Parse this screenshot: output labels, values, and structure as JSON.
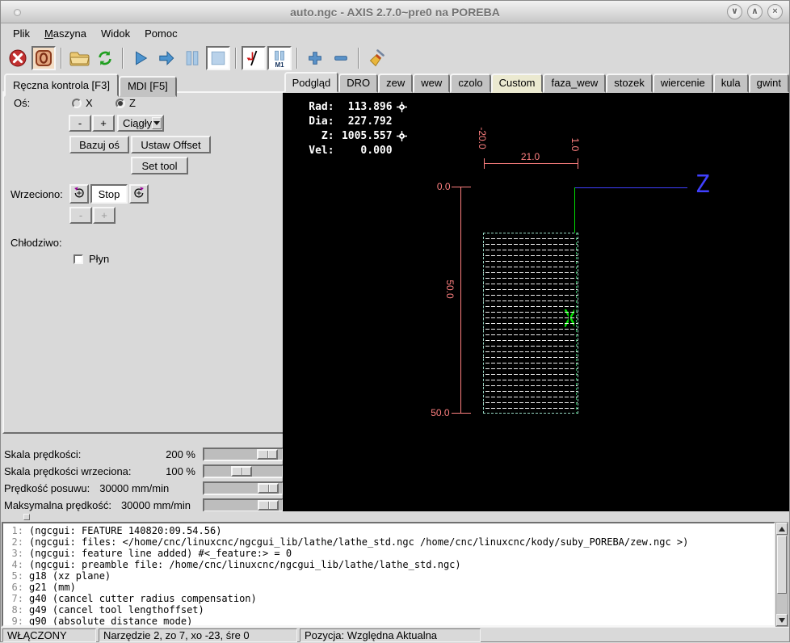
{
  "window": {
    "title": "auto.ngc - AXIS 2.7.0~pre0 na POREBA",
    "icons": {
      "minimize": "∨",
      "maximize": "∧",
      "close": "×"
    }
  },
  "menu": {
    "items": [
      {
        "u": "",
        "rest": "Plik"
      },
      {
        "u": "M",
        "rest": "aszyna"
      },
      {
        "u": "",
        "rest": "Widok"
      },
      {
        "u": "",
        "rest": "Pomoc"
      }
    ]
  },
  "toolbar": {
    "m1_label": "M1"
  },
  "left_panel": {
    "tabs": [
      {
        "label": "Ręczna kontrola [F3]"
      },
      {
        "label": "MDI [F5]"
      }
    ],
    "axis_row": {
      "label": "Oś:",
      "options": [
        {
          "label": "X",
          "selected": false
        },
        {
          "label": "Z",
          "selected": true
        }
      ]
    },
    "jog": {
      "minus": "-",
      "plus": "+",
      "mode": "Ciągły"
    },
    "buttons": {
      "home": "Bazuj oś",
      "offset": "Ustaw Offset",
      "set_tool": "Set tool"
    },
    "spindle": {
      "label": "Wrzeciono:",
      "stop": "Stop",
      "minus": "-",
      "plus": "+"
    },
    "coolant": {
      "label": "Chłodziwo:",
      "flood": "Płyn"
    },
    "sliders": [
      {
        "label": "Skala prędkości:",
        "value": "200 %"
      },
      {
        "label": "Skala prędkości wrzeciona:",
        "value": "100 %"
      },
      {
        "label": "Prędkość posuwu:",
        "value": "30000 mm/min"
      },
      {
        "label": "Maksymalna prędkość:",
        "value": "30000 mm/min"
      }
    ]
  },
  "right_panel": {
    "tabs": [
      {
        "label": "Podgląd"
      },
      {
        "label": "DRO"
      },
      {
        "label": "zew"
      },
      {
        "label": "wew"
      },
      {
        "label": "czolo"
      },
      {
        "label": "Custom"
      },
      {
        "label": "faza_wew"
      },
      {
        "label": "stozek"
      },
      {
        "label": "wiercenie"
      },
      {
        "label": "kula"
      },
      {
        "label": "gwint"
      }
    ]
  },
  "plot": {
    "dro": [
      {
        "label": "Rad:",
        "value": "113.896",
        "homed": true
      },
      {
        "label": "Dia:",
        "value": "227.792",
        "homed": false
      },
      {
        "label": "Z:",
        "value": "1005.557",
        "homed": true
      },
      {
        "label": "Vel:",
        "value": "0.000",
        "homed": false
      }
    ],
    "dimensions": {
      "left_of_origin": "-20.0",
      "width": "21.0",
      "right_of_origin": "1.0",
      "top": "0.0",
      "height": "50.0",
      "bottom": "50.0"
    },
    "axes": {
      "x": "X",
      "z": "Z"
    },
    "colors": {
      "dimension": "#ff8080",
      "x_axis": "#00dd00",
      "z_axis": "#4040ff",
      "hatch": "#ededed",
      "background": "#000000"
    }
  },
  "gcode": {
    "lines": [
      {
        "n": "1:",
        "text": "(ngcgui: FEATURE 140820:09.54.56)"
      },
      {
        "n": "2:",
        "text": "(ngcgui: files: </home/cnc/linuxcnc/ngcgui_lib/lathe/lathe_std.ngc /home/cnc/linuxcnc/kody/suby_POREBA/zew.ngc >)"
      },
      {
        "n": "3:",
        "text": "(ngcgui: feature line added) #<_feature:> = 0"
      },
      {
        "n": "4:",
        "text": "(ngcgui: preamble file: /home/cnc/linuxcnc/ngcgui_lib/lathe/lathe_std.ngc)"
      },
      {
        "n": "5:",
        "text": "g18 (xz plane)"
      },
      {
        "n": "6:",
        "text": "g21 (mm)"
      },
      {
        "n": "7:",
        "text": "g40 (cancel cutter radius compensation)"
      },
      {
        "n": "8:",
        "text": "g49 (cancel tool lengthoffset)"
      },
      {
        "n": "9:",
        "text": "g90 (absolute distance mode)"
      }
    ]
  },
  "statusbar": {
    "cells": [
      {
        "text": "WŁĄCZONY"
      },
      {
        "text": "Narzędzie 2, zo 7, xo -23, śre 0"
      },
      {
        "text": "Pozycja: Względna Aktualna"
      }
    ]
  }
}
